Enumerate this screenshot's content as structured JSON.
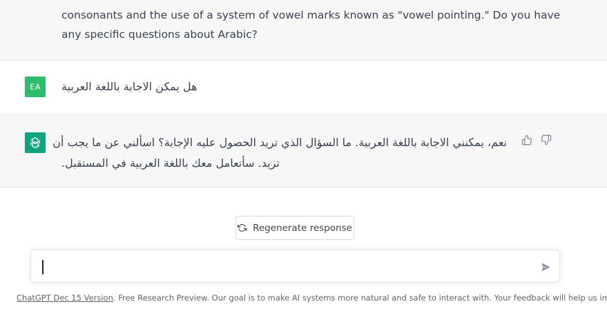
{
  "previous_message": {
    "lines": [
      "consonants and the use of a system of vowel marks known as \"vowel pointing.\" Do you have",
      "any specific questions about Arabic?"
    ]
  },
  "user_message": {
    "avatar_initials": "EA",
    "text": "هل يمكن الاجابة باللغة العربية"
  },
  "assistant_message": {
    "lines": [
      "نعم، يمكنني الاجابة باللغة العربية. ما السؤال الذي تريد الحصول عليه الإجابة؟ اسألني عن ما يجب أن",
      "تريد. سأتعامل معك باللغة العربية في المستقبل."
    ]
  },
  "regenerate": {
    "label": "Regenerate response"
  },
  "composer": {
    "value": ""
  },
  "footer": {
    "link": "ChatGPT Dec 15 Version",
    "text": ". Free Research Preview. Our goal is to make AI systems more natural and safe to interact with. Your feedback will help us improve."
  },
  "colors": {
    "user_avatar": "#2ebd6b",
    "assistant_avatar": "#10a37f",
    "message_bg_alt": "#f7f7f8"
  },
  "icons": {
    "assistant_avatar": "openai-logo-icon",
    "thumbs_up": "thumbs-up-icon",
    "thumbs_down": "thumbs-down-icon",
    "regenerate": "refresh-icon",
    "send": "send-icon"
  }
}
